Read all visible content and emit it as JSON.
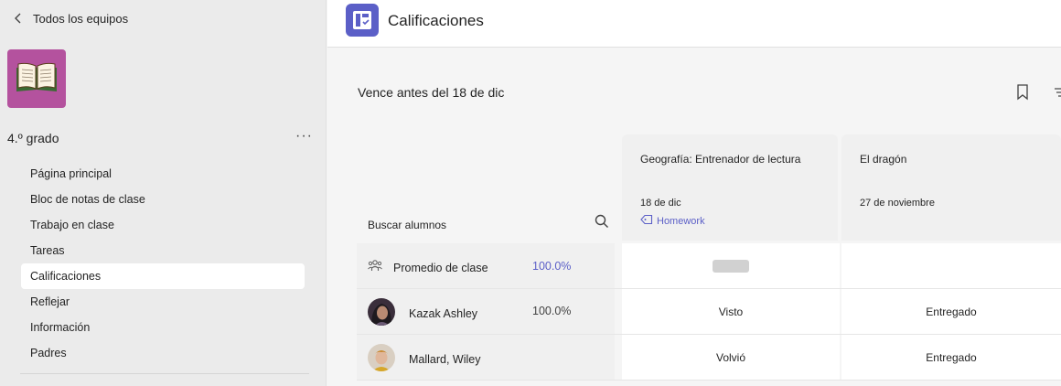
{
  "sidebar": {
    "back_label": "Todos los equipos",
    "team_name": "4.º grado",
    "more_label": "···",
    "nav": [
      {
        "label": "Página principal"
      },
      {
        "label": "Bloc de notas de clase"
      },
      {
        "label": "Trabajo en clase"
      },
      {
        "label": "Tareas"
      },
      {
        "label": "Calificaciones"
      },
      {
        "label": "Reflejar"
      },
      {
        "label": "Información"
      },
      {
        "label": "Padres"
      }
    ],
    "active_index": 4
  },
  "header": {
    "title": "Calificaciones"
  },
  "main": {
    "due_label": "Vence antes del 18 de dic",
    "search_label": "Buscar alumnos",
    "assignments": [
      {
        "title": "Geografía: Entrenador de lectura",
        "date": "18 de dic",
        "tag": "Homework"
      },
      {
        "title": "El dragón",
        "date": "27 de noviembre",
        "tag": ""
      }
    ],
    "class_average": {
      "label": "Promedio de clase",
      "value": "100.0%"
    },
    "students": [
      {
        "name": "Kazak Ashley",
        "average": "100.0%",
        "status1": "Visto",
        "status2": "Entregado"
      },
      {
        "name": "Mallard, Wiley",
        "average": "",
        "status1": "Volvió",
        "status2": "Entregado"
      }
    ]
  },
  "colors": {
    "accent": "#5b5fc7",
    "team_avatar": "#b4529e"
  },
  "icons": [
    "chevron-left-icon",
    "book-icon",
    "grades-app-icon",
    "bookmark-icon",
    "filter-icon",
    "search-icon",
    "tag-icon",
    "group-icon"
  ]
}
